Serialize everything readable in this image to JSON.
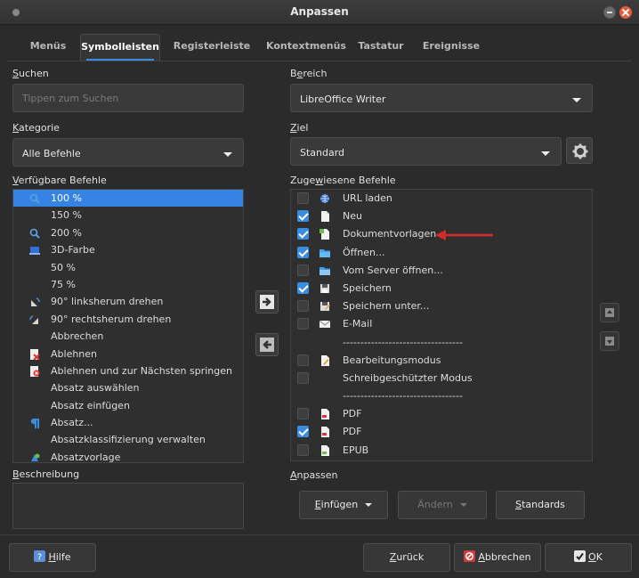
{
  "window": {
    "title": "Anpassen"
  },
  "tabs": [
    "Menüs",
    "Symbolleisten",
    "Registerleiste",
    "Kontextmenüs",
    "Tastatur",
    "Ereignisse"
  ],
  "active_tab": "Symbolleisten",
  "left": {
    "search_label_u": "S",
    "search_label_rest": "uchen",
    "search_placeholder": "Tippen zum Suchen",
    "category_label_u": "K",
    "category_label_rest": "ategorie",
    "category_value": "Alle Befehle",
    "available_label_u": "V",
    "available_label_rest": "erfügbare Befehle",
    "items": [
      {
        "label": "100 %",
        "icon": "zoom-icon",
        "selected": true
      },
      {
        "label": "150 %",
        "icon": ""
      },
      {
        "label": "200 %",
        "icon": "zoom-icon"
      },
      {
        "label": "3D-Farbe",
        "icon": "color-3d-icon"
      },
      {
        "label": "50 %",
        "icon": ""
      },
      {
        "label": "75 %",
        "icon": ""
      },
      {
        "label": "90° linksherum drehen",
        "icon": "rotate-left-icon"
      },
      {
        "label": "90° rechtsherum drehen",
        "icon": "rotate-right-icon"
      },
      {
        "label": "Abbrechen",
        "icon": ""
      },
      {
        "label": "Ablehnen",
        "icon": "reject-icon"
      },
      {
        "label": "Ablehnen und zur Nächsten springen",
        "icon": "reject-next-icon"
      },
      {
        "label": "Absatz auswählen",
        "icon": ""
      },
      {
        "label": "Absatz einfügen",
        "icon": ""
      },
      {
        "label": "Absatz...",
        "icon": "paragraph-icon"
      },
      {
        "label": "Absatzklassifizierung verwalten",
        "icon": ""
      },
      {
        "label": "Absatzvorlage",
        "icon": "style-icon"
      }
    ],
    "description_label_u": "B",
    "description_label_rest": "eschreibung"
  },
  "right": {
    "scope_label_pre": "B",
    "scope_label_u": "e",
    "scope_label_rest": "reich",
    "scope_value": "LibreOffice Writer",
    "target_label_u": "Z",
    "target_label_rest": "iel",
    "target_value": "Standard",
    "assigned_label_pre": "Zuge",
    "assigned_label_u": "w",
    "assigned_label_rest": "iesene Befehle",
    "items": [
      {
        "label": "URL laden",
        "checked": false,
        "icon": "globe-icon"
      },
      {
        "label": "Neu",
        "checked": true,
        "icon": "new-doc-icon"
      },
      {
        "label": "Dokumentvorlagen",
        "checked": true,
        "icon": "templates-icon"
      },
      {
        "label": "Öffnen...",
        "checked": true,
        "icon": "folder-icon"
      },
      {
        "label": "Vom Server öffnen...",
        "checked": false,
        "icon": "folder-remote-icon"
      },
      {
        "label": "Speichern",
        "checked": true,
        "icon": "save-icon"
      },
      {
        "label": "Speichern unter...",
        "checked": false,
        "icon": "save-as-icon"
      },
      {
        "label": "E-Mail",
        "checked": false,
        "icon": "mail-icon"
      },
      {
        "label": "----------------------------------",
        "checked": null,
        "icon": ""
      },
      {
        "label": "Bearbeitungsmodus",
        "checked": false,
        "icon": "edit-mode-icon"
      },
      {
        "label": "Schreibgeschützter Modus",
        "checked": false,
        "icon": ""
      },
      {
        "label": "----------------------------------",
        "checked": null,
        "icon": ""
      },
      {
        "label": "PDF",
        "checked": false,
        "icon": "pdf-icon"
      },
      {
        "label": "PDF",
        "checked": true,
        "icon": "pdf-icon"
      },
      {
        "label": "EPUB",
        "checked": false,
        "icon": "epub-icon"
      }
    ],
    "customize_label_u": "A",
    "customize_label_rest": "npassen",
    "insert_label_u": "E",
    "insert_label_rest": "infügen",
    "modify_label": "Ändern",
    "defaults_label_u": "S",
    "defaults_label_rest": "tandards"
  },
  "footer": {
    "help_u": "H",
    "help_rest": "ilfe",
    "back_u": "Z",
    "back_rest": "urück",
    "cancel_u": "A",
    "cancel_rest": "bbrechen",
    "ok_pre": "",
    "ok_u": "O",
    "ok_rest": "K"
  },
  "colors": {
    "accent": "#3584e4",
    "annotation": "#d42a2a"
  }
}
